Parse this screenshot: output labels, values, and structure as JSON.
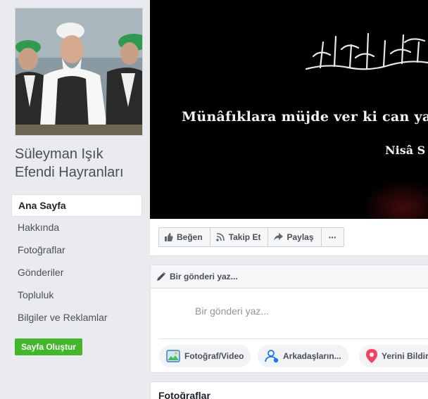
{
  "page": {
    "name": "Süleyman Işık Efendi Hayranları"
  },
  "nav": {
    "items": [
      {
        "label": "Ana Sayfa",
        "active": true
      },
      {
        "label": "Hakkında"
      },
      {
        "label": "Fotoğraflar"
      },
      {
        "label": "Gönderiler"
      },
      {
        "label": "Topluluk"
      },
      {
        "label": "Bilgiler ve Reklamlar"
      }
    ],
    "create_page_label": "Sayfa Oluştur"
  },
  "cover": {
    "line1": "Münâfıklara müjde ver ki can yakı",
    "line2": "Nisâ S"
  },
  "actions": {
    "like": "Beğen",
    "follow": "Takip Et",
    "share": "Paylaş",
    "more": "···"
  },
  "composer": {
    "header": "Bir gönderi yaz...",
    "placeholder": "Bir gönderi yaz...",
    "photo_video": "Fotoğraf/Video",
    "tag_friends": "Arkadaşların...",
    "check_in": "Yerini Bildir"
  },
  "photos_section": {
    "title": "Fotoğraflar"
  },
  "colors": {
    "background": "#e9ebee",
    "create_button": "#42b72a",
    "checkin_icon": "#f3425f",
    "tag_icon": "#1877f2",
    "photo_icon": "#45bd62"
  }
}
